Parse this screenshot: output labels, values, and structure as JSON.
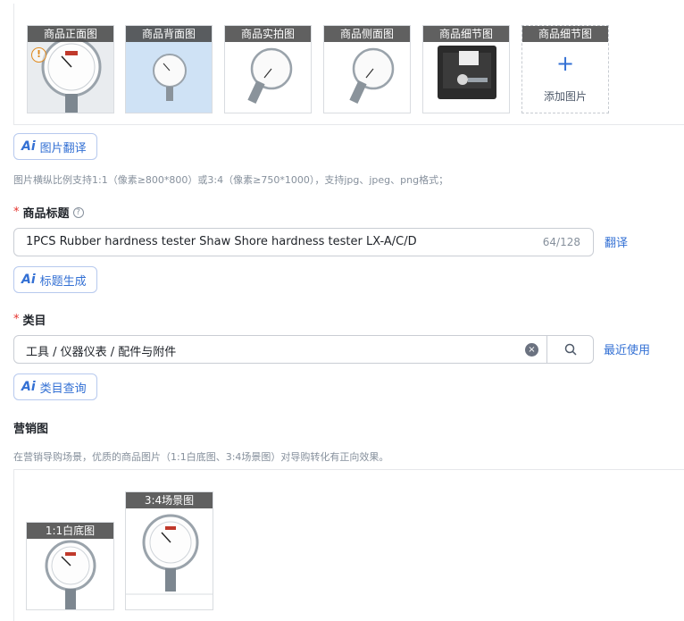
{
  "gallery": {
    "images": [
      {
        "caption": "商品正面图",
        "icon": "tester-front-photo"
      },
      {
        "caption": "商品背面图",
        "icon": "tester-back-photo"
      },
      {
        "caption": "商品实拍图",
        "icon": "tester-real-photo"
      },
      {
        "caption": "商品侧面图",
        "icon": "tester-side-photo"
      },
      {
        "caption": "商品细节图",
        "icon": "tester-case-photo"
      }
    ],
    "add_slot": {
      "caption": "商品细节图",
      "plus": "+",
      "label": "添加图片"
    },
    "warning_glyph": "!"
  },
  "ai_translate_button": {
    "ai": "Ai",
    "label": "图片翻译"
  },
  "image_hint": "图片横纵比例支持1:1（像素≥800*800）或3:4（像素≥750*1000），支持jpg、jpeg、png格式；",
  "title_section": {
    "required_mark": "*",
    "label": "商品标题",
    "help_glyph": "?",
    "value": "1PCS  Rubber hardness tester Shaw Shore hardness tester LX-A/C/D",
    "count": "64/128",
    "translate_link": "翻译",
    "ai_button": {
      "ai": "Ai",
      "label": "标题生成"
    }
  },
  "category_section": {
    "required_mark": "*",
    "label": "类目",
    "value": "工具 / 仪器仪表 / 配件与附件",
    "clear_glyph": "×",
    "recent_link": "最近使用",
    "ai_button": {
      "ai": "Ai",
      "label": "类目查询"
    }
  },
  "marketing_section": {
    "label": "营销图",
    "hint": "在营销导购场景，优质的商品图片（1:1白底图、3:4场景图）对导购转化有正向效果。",
    "images": [
      {
        "caption": "1:1白底图",
        "icon": "tester-white-bg-photo"
      },
      {
        "caption": "3:4场景图",
        "icon": "tester-scene-photo"
      }
    ]
  },
  "colors": {
    "accent": "#3370d4",
    "required": "#e5322d",
    "warning": "#e08a1e",
    "caption_bg": "#464646"
  }
}
